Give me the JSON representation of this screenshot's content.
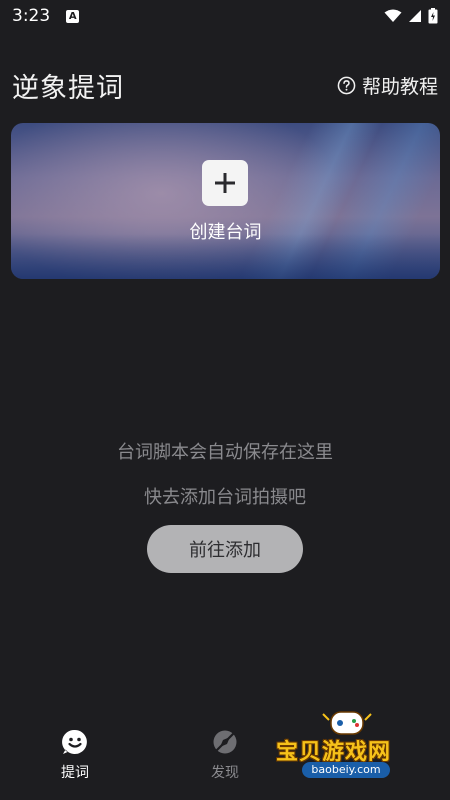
{
  "status_bar": {
    "time": "3:23",
    "notification_icon": "a-icon"
  },
  "header": {
    "title": "逆象提词",
    "help_label": "帮助教程",
    "help_icon": "question-circle-icon"
  },
  "create_card": {
    "label": "创建台词",
    "icon": "plus-icon"
  },
  "empty_state": {
    "line1": "台词脚本会自动保存在这里",
    "line2": "快去添加台词拍摄吧",
    "button_label": "前往添加"
  },
  "bottom_nav": {
    "items": [
      {
        "label": "提词",
        "icon": "smile-bubble-icon",
        "active": true
      },
      {
        "label": "发现",
        "icon": "compass-icon",
        "active": false
      }
    ]
  },
  "watermark": {
    "text": "宝贝游戏网",
    "url": "baobeiy.com"
  },
  "colors": {
    "background": "#1d1d20",
    "empty_text": "#8a8a8e",
    "button_bg": "#b3b3b5",
    "watermark_text": "#f6c21a"
  }
}
